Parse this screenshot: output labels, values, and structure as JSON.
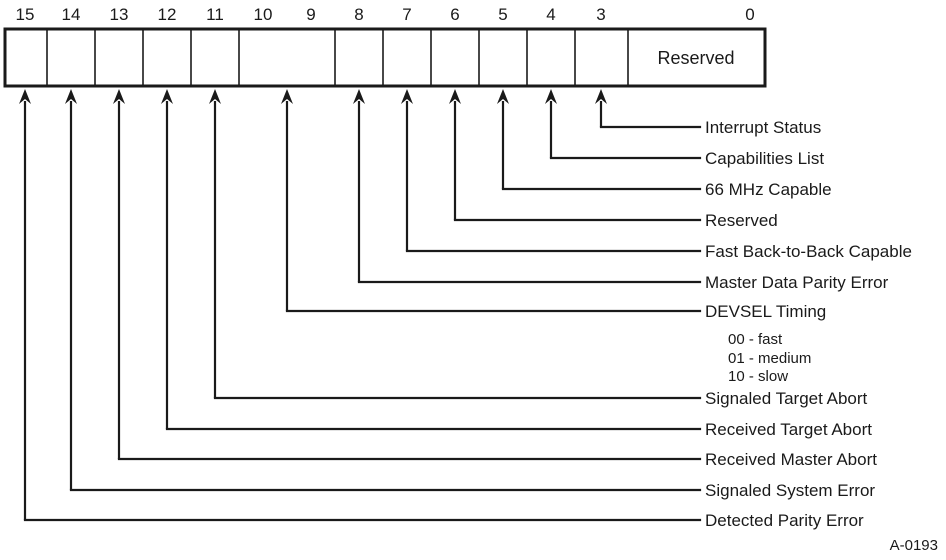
{
  "figure": {
    "id_label": "A-0193",
    "reserved_cell_label": "Reserved"
  },
  "register": {
    "bit_numbers": [
      "15",
      "14",
      "13",
      "12",
      "11",
      "10",
      "9",
      "8",
      "7",
      "6",
      "5",
      "4",
      "3",
      "0"
    ]
  },
  "fields": [
    {
      "bit": "3",
      "label": "Interrupt Status"
    },
    {
      "bit": "4",
      "label": "Capabilities List"
    },
    {
      "bit": "5",
      "label": "66 MHz Capable"
    },
    {
      "bit": "6",
      "label": "Reserved"
    },
    {
      "bit": "7",
      "label": "Fast Back-to-Back Capable"
    },
    {
      "bit": "8",
      "label": "Master Data Parity Error"
    },
    {
      "bit": "10:9",
      "label": "DEVSEL Timing"
    },
    {
      "bit": "11",
      "label": "Signaled Target Abort"
    },
    {
      "bit": "12",
      "label": "Received Target Abort"
    },
    {
      "bit": "13",
      "label": "Received Master Abort"
    },
    {
      "bit": "14",
      "label": "Signaled System Error"
    },
    {
      "bit": "15",
      "label": "Detected Parity Error"
    }
  ],
  "devsel_encodings": [
    "00 - fast",
    "01 - medium",
    "10 - slow"
  ]
}
